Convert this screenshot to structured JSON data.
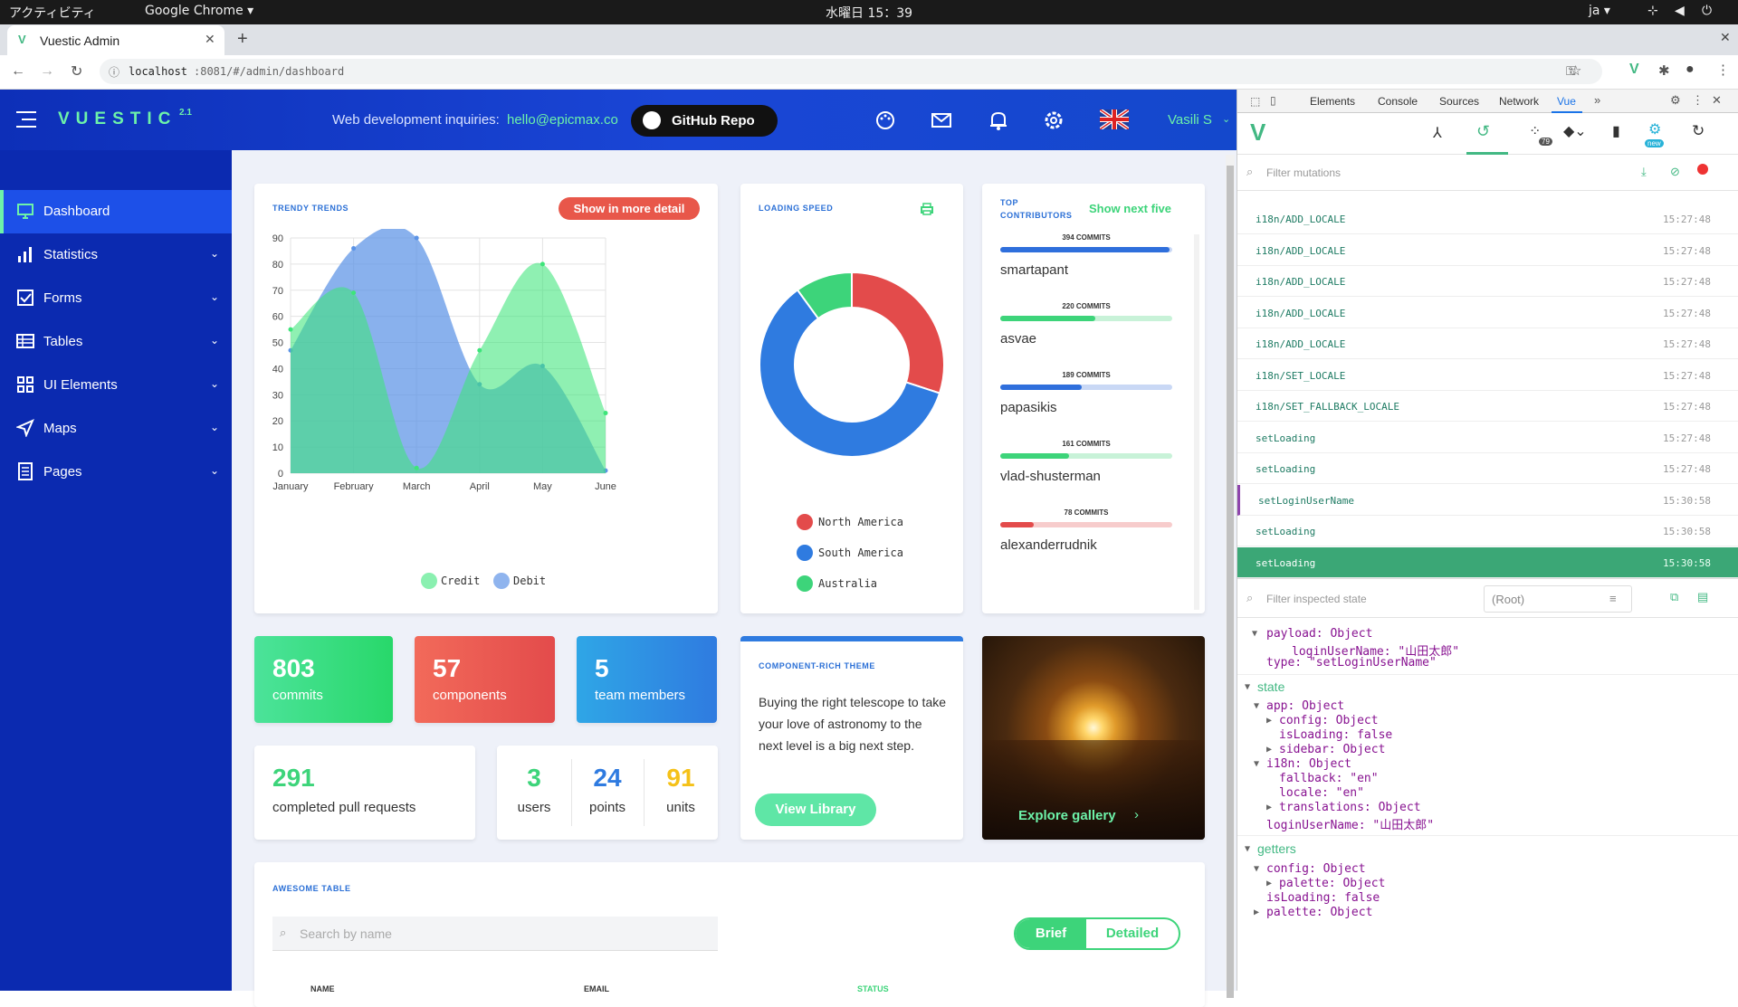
{
  "os": {
    "activities": "アクティビティ",
    "app": "Google Chrome ▾",
    "clock": "水曜日 15：39",
    "lang": "ja ▾"
  },
  "browser": {
    "tab_title": "Vuestic Admin",
    "url_host": "localhost",
    "url_rest": ":8081/#/admin/dashboard"
  },
  "header": {
    "logo": "VUESTIC",
    "version": "2.1",
    "inquiry": "Web development inquiries:",
    "email": "hello@epicmax.co",
    "github": "GitHub Repo",
    "user": "Vasili S"
  },
  "sidebar": {
    "items": [
      {
        "label": "Dashboard",
        "icon": "dashboard-icon"
      },
      {
        "label": "Statistics",
        "icon": "bar-chart-icon"
      },
      {
        "label": "Forms",
        "icon": "checkbox-icon"
      },
      {
        "label": "Tables",
        "icon": "table-icon"
      },
      {
        "label": "UI Elements",
        "icon": "grid-icon"
      },
      {
        "label": "Maps",
        "icon": "navigation-icon"
      },
      {
        "label": "Pages",
        "icon": "document-icon"
      }
    ]
  },
  "trendy": {
    "title": "TRENDY TRENDS",
    "button": "Show in more detail"
  },
  "loading": {
    "title": "LOADING SPEED"
  },
  "contributors": {
    "title1": "TOP",
    "title2": "CONTRIBUTORS",
    "next": "Show next five",
    "list": [
      {
        "commits": "394 COMMITS",
        "name": "smartapant",
        "value": 394,
        "color": "#2f6fdc",
        "track": "#c9d8f5"
      },
      {
        "commits": "220 COMMITS",
        "name": "asvae",
        "value": 220,
        "color": "#3dd47a",
        "track": "#c8f2d8"
      },
      {
        "commits": "189 COMMITS",
        "name": "papasikis",
        "value": 189,
        "color": "#2f6fdc",
        "track": "#c9d8f5"
      },
      {
        "commits": "161 COMMITS",
        "name": "vlad-shusterman",
        "value": 161,
        "color": "#3dd47a",
        "track": "#c8f2d8"
      },
      {
        "commits": "78 COMMITS",
        "name": "alexanderrudnik",
        "value": 78,
        "color": "#e34b4b",
        "track": "#f7cccc"
      }
    ]
  },
  "stats": {
    "commits_value": "803",
    "commits_label": "commits",
    "components_value": "57",
    "components_label": "components",
    "team_value": "5",
    "team_label": "team members",
    "prs_value": "291",
    "prs_label": "completed pull requests",
    "users_value": "3",
    "users_label": "users",
    "points_value": "24",
    "points_label": "points",
    "units_value": "91",
    "units_label": "units"
  },
  "theme": {
    "title": "COMPONENT-RICH THEME",
    "text": "Buying the right telescope to take your love of astronomy to the next level is a big next step.",
    "button": "View Library"
  },
  "gallery": {
    "button": "Explore gallery"
  },
  "table": {
    "title": "AWESOME TABLE",
    "search_placeholder": "Search by name",
    "brief": "Brief",
    "detailed": "Detailed",
    "col_name": "NAME",
    "col_email": "EMAIL",
    "col_status": "STATUS"
  },
  "devtools": {
    "tabs": [
      "Elements",
      "Console",
      "Sources",
      "Network",
      "Vue"
    ],
    "filter_mutations": "Filter mutations",
    "filter_state": "Filter inspected state",
    "root": "(Root)",
    "badge": "79",
    "new": "new",
    "mutations": [
      {
        "name": "i18n/ADD_LOCALE",
        "time": "15:27:48"
      },
      {
        "name": "i18n/ADD_LOCALE",
        "time": "15:27:48"
      },
      {
        "name": "i18n/ADD_LOCALE",
        "time": "15:27:48"
      },
      {
        "name": "i18n/ADD_LOCALE",
        "time": "15:27:48"
      },
      {
        "name": "i18n/ADD_LOCALE",
        "time": "15:27:48"
      },
      {
        "name": "i18n/SET_LOCALE",
        "time": "15:27:48"
      },
      {
        "name": "i18n/SET_FALLBACK_LOCALE",
        "time": "15:27:48"
      },
      {
        "name": "setLoading",
        "time": "15:27:48"
      },
      {
        "name": "setLoading",
        "time": "15:27:48"
      },
      {
        "name": "setLoginUserName",
        "time": "15:30:58"
      },
      {
        "name": "setLoading",
        "time": "15:30:58"
      },
      {
        "name": "setLoading",
        "time": "15:30:58"
      }
    ],
    "state": {
      "l1": "payload: Object",
      "l2": "loginUserName: \"山田太郎\"",
      "l3": "type: \"setLoginUserName\"",
      "state": "state",
      "app": "app: Object",
      "config": "config: Object",
      "isLoading": "isLoading: false",
      "sidebarobj": "sidebar: Object",
      "i18n": "i18n: Object",
      "fallback": "fallback: \"en\"",
      "locale": "locale: \"en\"",
      "translations": "translations: Object",
      "login": "loginUserName: \"山田太郎\"",
      "getters": "getters",
      "gconfig": "config: Object",
      "palette": "palette: Object",
      "gisLoading": "isLoading: false",
      "gpalette": "palette: Object"
    }
  },
  "chart_data": [
    {
      "type": "area",
      "title": "TRENDY TRENDS",
      "categories": [
        "January",
        "February",
        "March",
        "April",
        "May",
        "June"
      ],
      "ylim": [
        0,
        90
      ],
      "yticks": [
        0,
        10,
        20,
        30,
        40,
        50,
        60,
        70,
        80,
        90
      ],
      "series": [
        {
          "name": "Credit",
          "color": "#3ee57a",
          "values": [
            55,
            69,
            2,
            47,
            80,
            23
          ]
        },
        {
          "name": "Debit",
          "color": "#5b93e6",
          "values": [
            47,
            86,
            90,
            34,
            41,
            1
          ]
        }
      ]
    },
    {
      "type": "pie",
      "title": "LOADING SPEED",
      "slices": [
        {
          "name": "North America",
          "value": 30,
          "color": "#e34b4b"
        },
        {
          "name": "South America",
          "value": 60,
          "color": "#2f7be0"
        },
        {
          "name": "Australia",
          "value": 10,
          "color": "#3dd47a"
        }
      ]
    }
  ]
}
